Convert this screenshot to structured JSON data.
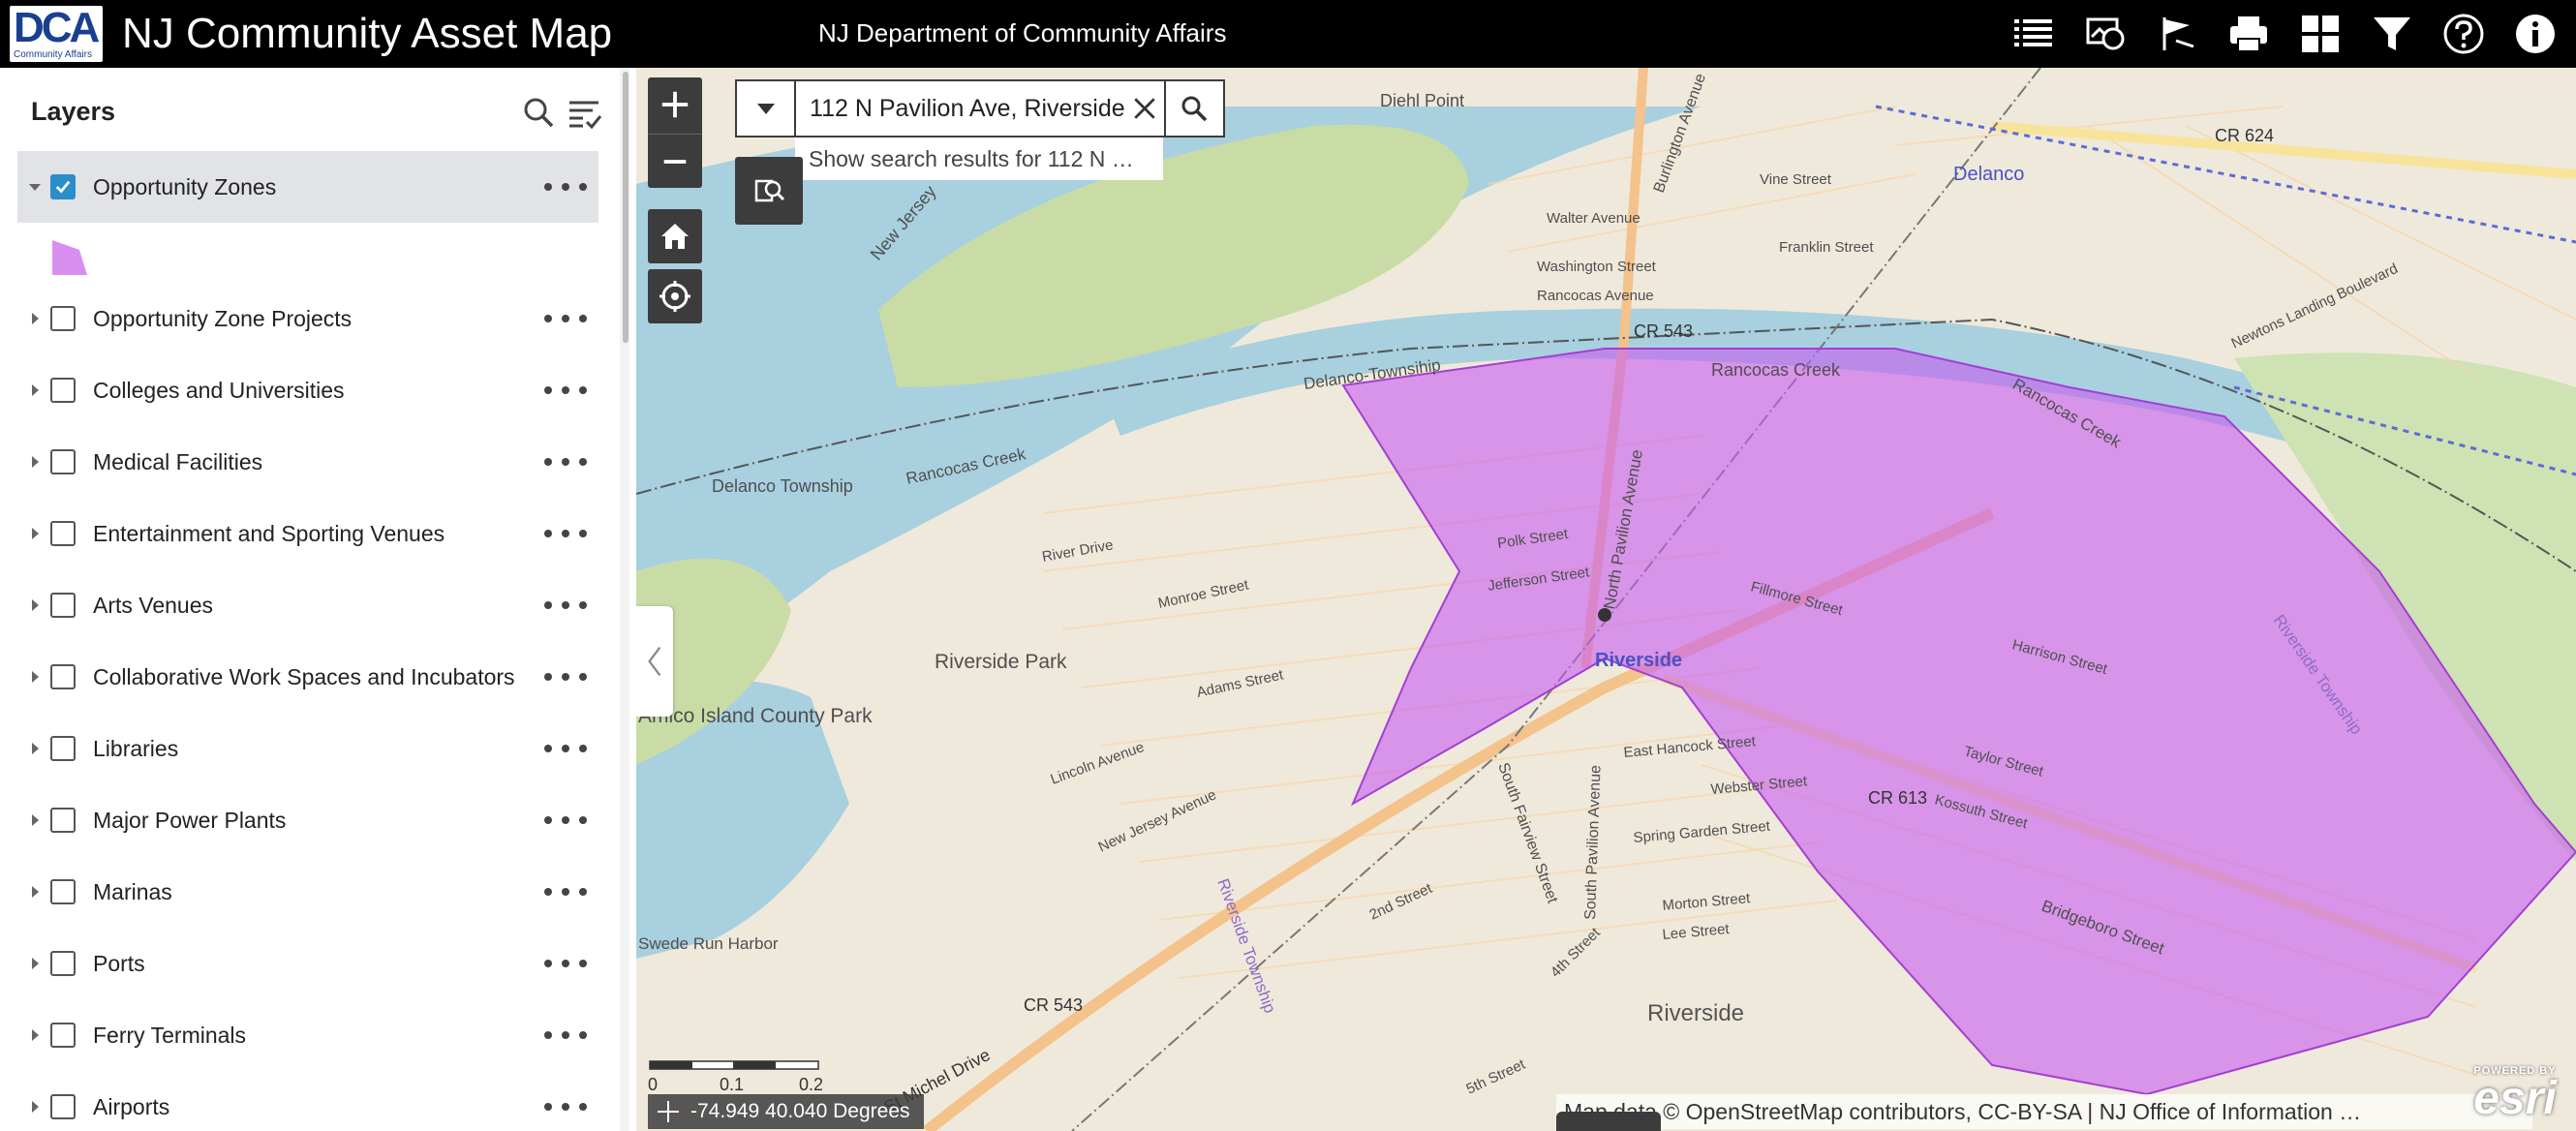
{
  "header": {
    "logo_text": "DCA",
    "logo_subtext": "Community Affairs",
    "app_title": "NJ Community Asset Map",
    "dept_title": "NJ Department of Community Affairs"
  },
  "sidebar": {
    "title": "Layers",
    "layers": [
      {
        "label": "Opportunity Zones",
        "checked": true,
        "expanded": true
      },
      {
        "label": "Opportunity Zone Projects",
        "checked": false
      },
      {
        "label": "Colleges and Universities",
        "checked": false
      },
      {
        "label": "Medical Facilities",
        "checked": false
      },
      {
        "label": "Entertainment and Sporting Venues",
        "checked": false
      },
      {
        "label": "Arts Venues",
        "checked": false
      },
      {
        "label": "Collaborative Work Spaces and Incubators",
        "checked": false
      },
      {
        "label": "Libraries",
        "checked": false
      },
      {
        "label": "Major Power Plants",
        "checked": false
      },
      {
        "label": "Marinas",
        "checked": false
      },
      {
        "label": "Ports",
        "checked": false
      },
      {
        "label": "Ferry Terminals",
        "checked": false
      },
      {
        "label": "Airports",
        "checked": false
      }
    ],
    "legend_color": "#d98ff0"
  },
  "search": {
    "value": "112 N Pavilion Ave, Riverside",
    "suggestion": "Show search results for 112 N …"
  },
  "map": {
    "labels": {
      "diehl_point": "Diehl Point",
      "new_jersey": "New Jersey",
      "delanco_township": "Delanco Township",
      "rancocas_creek": "Rancocas Creek",
      "delanco_townsihp": "Delanco-Townsihip",
      "delanco": "Delanco",
      "riverside": "Riverside",
      "riverside_park": "Riverside Park",
      "amico_island": "Amico Island County Park",
      "riverside_township": "Riverside Township",
      "swede_run": "Swede Run Harbor",
      "burlington_avenue": "Burlington Avenue",
      "north_pavilion_avenue": "North Pavilion Avenue",
      "south_pavilion_avenue": "South Pavilion Avenue",
      "south_fairview_street": "South Fairview Street",
      "bridgeboro_street": "Bridgeboro Street",
      "cr543": "CR 543",
      "cr624": "CR 624",
      "cr613": "CR 613",
      "polk_street": "Polk Street",
      "jefferson_street": "Jefferson Street",
      "monroe_street": "Monroe Street",
      "adams_street": "Adams Street",
      "lincoln_avenue": "Lincoln Avenue",
      "new_jersey_avenue": "New Jersey Avenue",
      "st_michel_drive": "St Michel Drive",
      "harrison_street": "Harrison Street",
      "fillmore_street": "Fillmore Street",
      "taylor_street": "Taylor Street",
      "kossuth_street": "Kossuth Street",
      "webster_street": "Webster Street",
      "east_hancock_street": "East Hancock Street",
      "spring_garden_street": "Spring Garden Street",
      "morton_street": "Morton Street",
      "lee_street": "Lee Street",
      "walter_avenue": "Walter Avenue",
      "washington_street": "Washington Street",
      "rancocas_avenue": "Rancocas Avenue",
      "vine_street": "Vine Street",
      "franklin_street": "Franklin Street",
      "river_drive": "River Drive",
      "newtons_landing": "Newtons Landing Boulevard",
      "second_street": "2nd Street",
      "fourth_street": "4th Street",
      "fifth_street": "5th Street"
    },
    "scale": {
      "ticks": [
        "0",
        "0.1",
        "0.2mi"
      ]
    },
    "coordinates": "-74.949 40.040 Degrees",
    "attribution": "Map data © OpenStreetMap contributors, CC-BY-SA | NJ Office of Information …",
    "esri_powered": "POWERED BY",
    "esri": "esri"
  }
}
